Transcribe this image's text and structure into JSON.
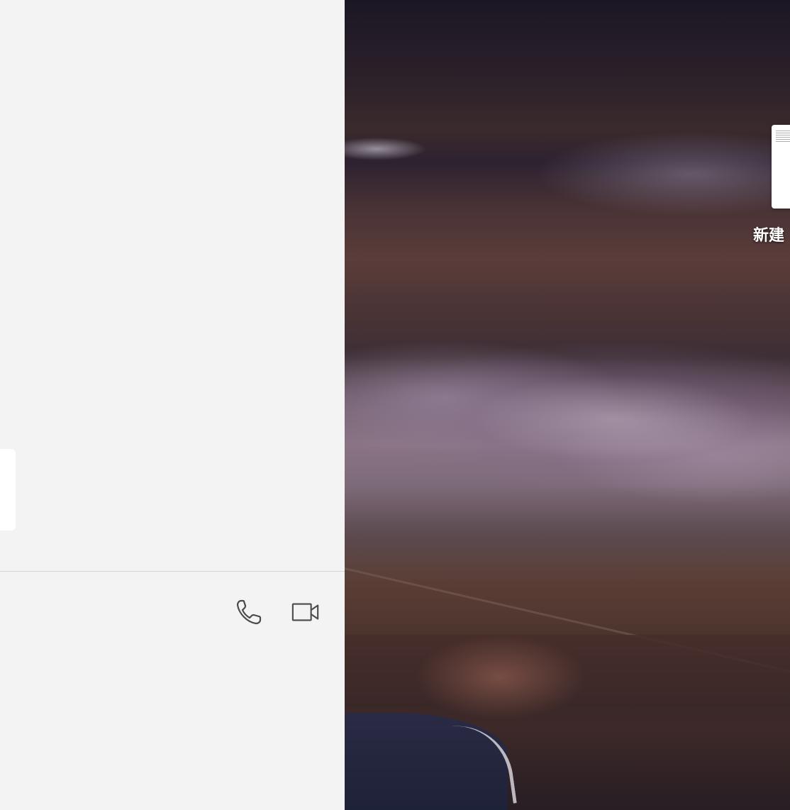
{
  "chat": {
    "toolbar": {
      "voice_call_icon": "phone-icon",
      "video_call_icon": "video-camera-icon"
    }
  },
  "desktop": {
    "file_label": "新建"
  },
  "colors": {
    "chat_background": "#f3f3f3",
    "bubble": "#ffffff",
    "divider": "#d6d6d6",
    "icon_stroke": "#4a4a4a"
  }
}
